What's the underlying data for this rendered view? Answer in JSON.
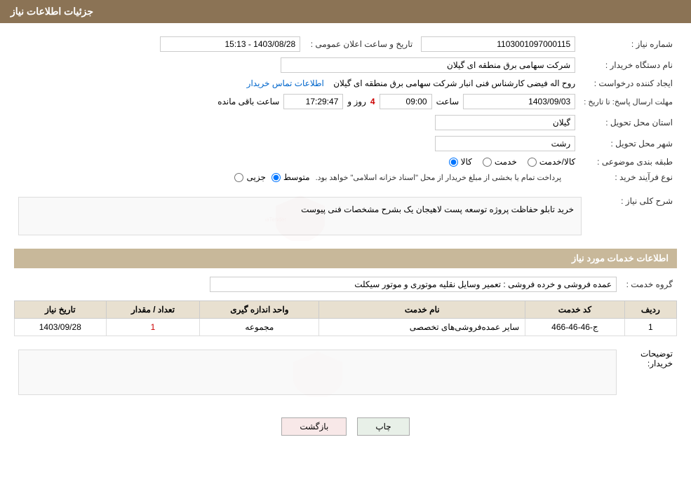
{
  "header": {
    "title": "جزئیات اطلاعات نیاز"
  },
  "fields": {
    "need_number_label": "شماره نیاز :",
    "need_number_value": "1103001097000115",
    "buyer_org_label": "نام دستگاه خریدار :",
    "buyer_org_value": "شرکت سهامی برق منطقه ای گیلان",
    "creator_label": "ایجاد کننده درخواست :",
    "creator_value": "روح اله فیضی کارشناس فنی انبار شرکت سهامی برق منطقه ای گیلان",
    "contact_link": "اطلاعات تماس خریدار",
    "deadline_label": "مهلت ارسال پاسخ: تا تاریخ :",
    "deadline_date": "1403/09/03",
    "deadline_time_label": "ساعت",
    "deadline_time": "09:00",
    "deadline_day_label": "روز و",
    "deadline_days": "4",
    "deadline_remaining_label": "ساعت باقی مانده",
    "deadline_remaining": "17:29:47",
    "announce_label": "تاریخ و ساعت اعلان عمومی :",
    "announce_value": "1403/08/28 - 15:13",
    "province_label": "استان محل تحویل :",
    "province_value": "گیلان",
    "city_label": "شهر محل تحویل :",
    "city_value": "رشت",
    "category_label": "طبقه بندی موضوعی :",
    "category_kala": "کالا",
    "category_khadamat": "خدمت",
    "category_kala_khadamat": "کالا/خدمت",
    "purchase_type_label": "نوع فرآیند خرید :",
    "purchase_jozii": "جزیی",
    "purchase_motavaset": "متوسط",
    "purchase_notice": "پرداخت تمام یا بخشی از مبلغ خریدار از محل \"اسناد خزانه اسلامی\" خواهد بود.",
    "description_label": "شرح کلی نیاز :",
    "description_value": "خرید تابلو حفاظت پروژه توسعه پست لاهیجان یک بشرح مشخصات فنی پیوست",
    "services_header": "اطلاعات خدمات مورد نیاز",
    "service_group_label": "گروه خدمت :",
    "service_group_value": "عمده فروشی و خرده فروشی : تعمیر وسایل نقلیه موتوری و موتور سیکلت",
    "table_headers": {
      "radif": "ردیف",
      "code": "کد خدمت",
      "name": "نام خدمت",
      "unit": "واحد اندازه گیری",
      "qty": "تعداد / مقدار",
      "date": "تاریخ نیاز"
    },
    "table_rows": [
      {
        "radif": "1",
        "code": "ج-46-46-466",
        "name": "سایر عمده‌فروشی‌های تخصصی",
        "unit": "مجموعه",
        "qty": "1",
        "date": "1403/09/28"
      }
    ],
    "buyer_notes_label": "توضیحات خریدار:",
    "buyer_notes_value": ""
  },
  "buttons": {
    "print": "چاپ",
    "back": "بازگشت"
  }
}
